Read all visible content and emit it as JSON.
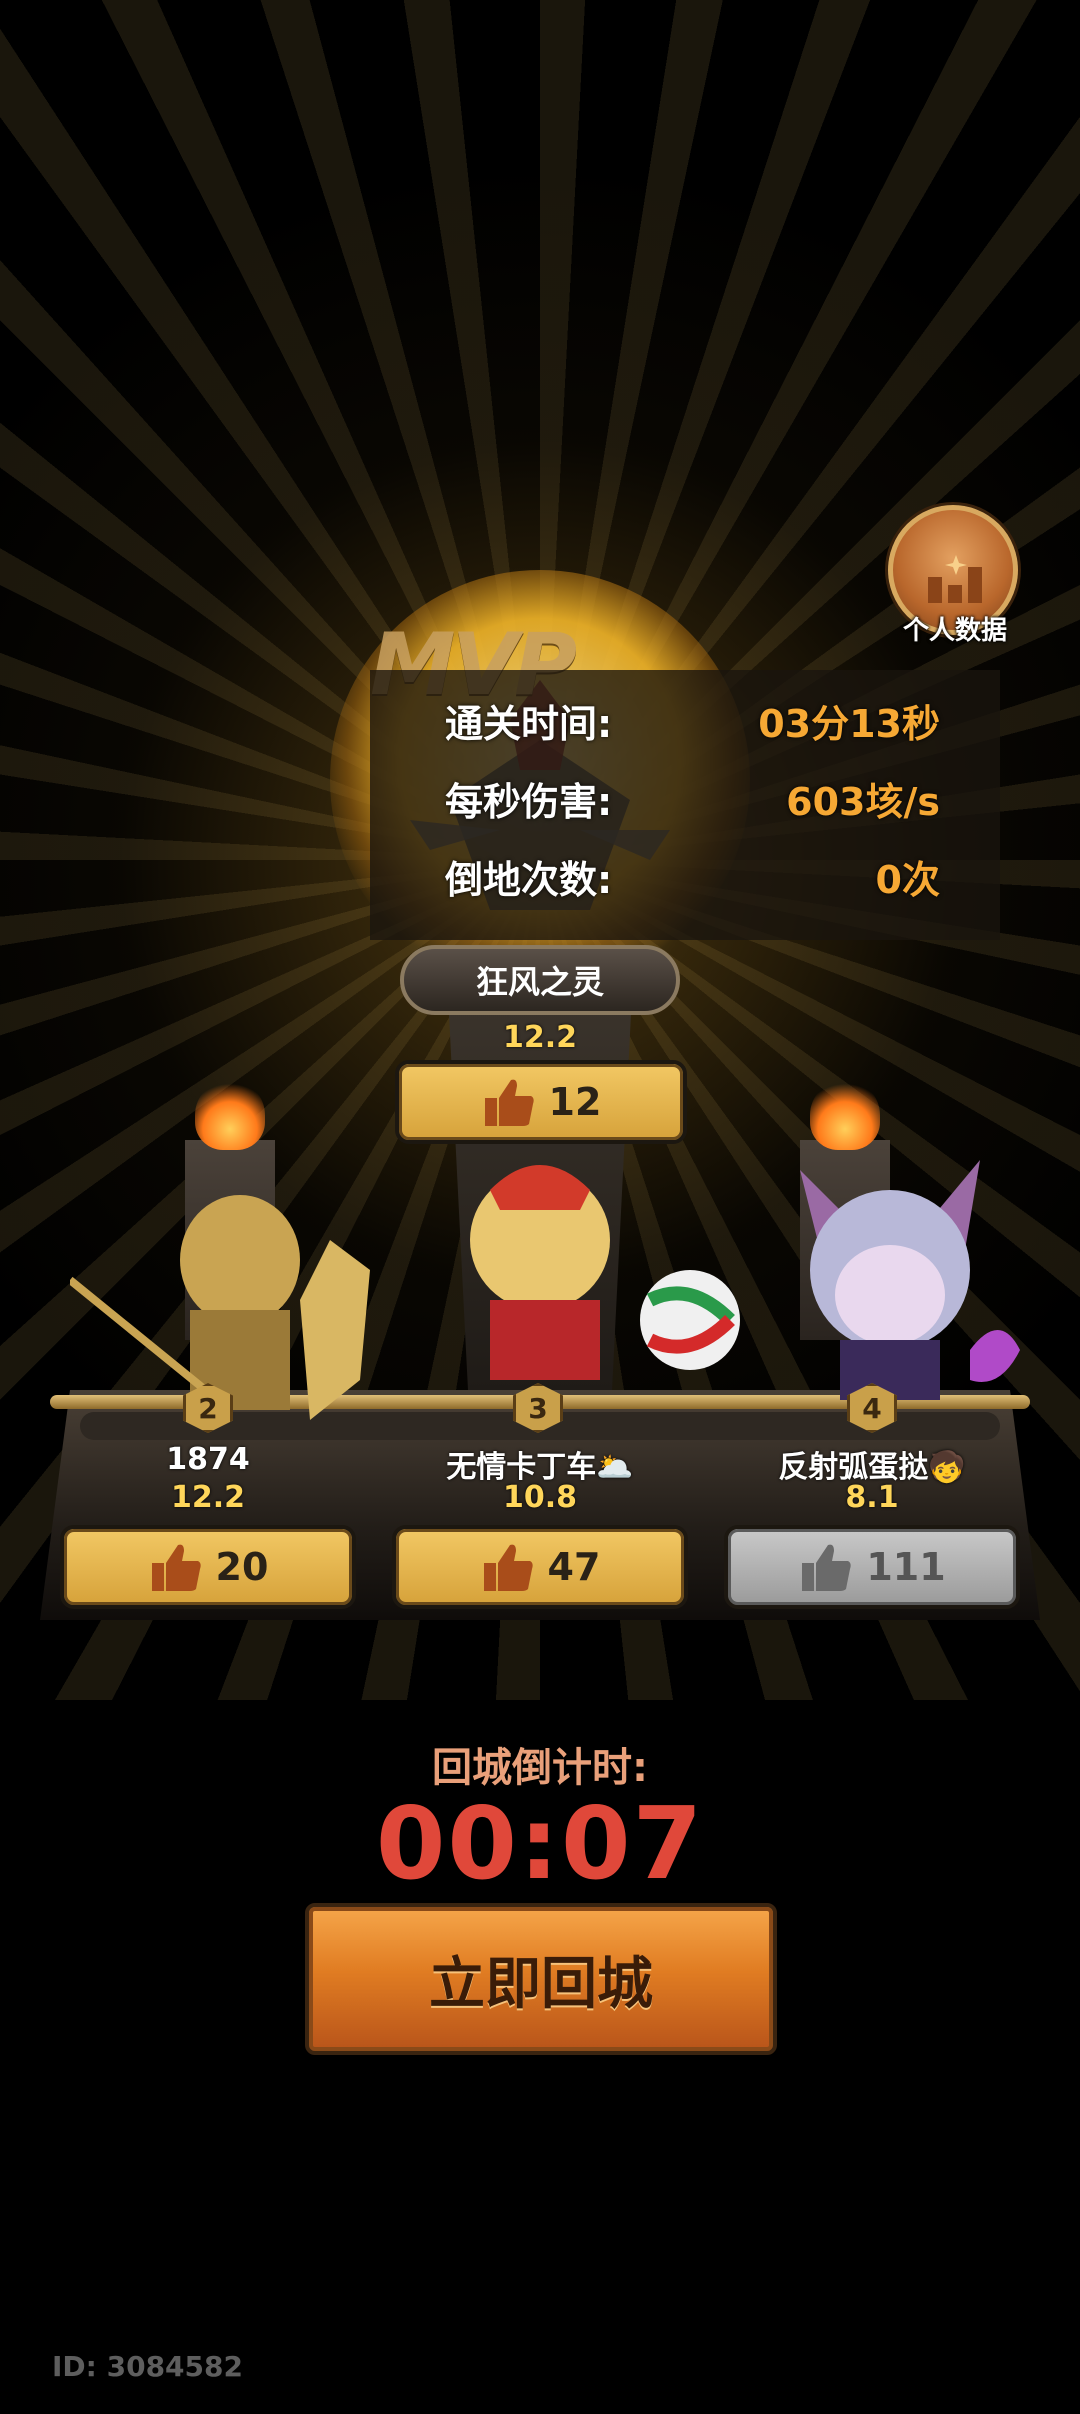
{
  "stats_button": {
    "label": "个人数据"
  },
  "mvp": {
    "badge_text": "MVP",
    "stats": [
      {
        "label": "通关时间:",
        "value": "03分13秒"
      },
      {
        "label": "每秒伤害:",
        "value": "603垓/s"
      },
      {
        "label": "倒地次数:",
        "value": "0次"
      }
    ],
    "player_name": "狂风之灵",
    "score": "12.2",
    "likes": "12"
  },
  "players": [
    {
      "rank": "2",
      "name": "1874",
      "score": "12.2",
      "likes": "20",
      "liked": false
    },
    {
      "rank": "3",
      "name": "无情卡丁车🌥️",
      "score": "10.8",
      "likes": "47",
      "liked": false
    },
    {
      "rank": "4",
      "name": "反射弧蛋挞🧒",
      "score": "8.1",
      "likes": "111",
      "liked": true
    }
  ],
  "countdown": {
    "label": "回城倒计时:",
    "time": "00:07"
  },
  "return_button": {
    "label": "立即回城"
  },
  "footer": {
    "id_text": "ID: 3084582"
  },
  "colors": {
    "accent_orange": "#f6a834",
    "countdown_red": "#e0483a",
    "gold_button": "#e6b54e",
    "gray_button": "#b0b0b0"
  }
}
